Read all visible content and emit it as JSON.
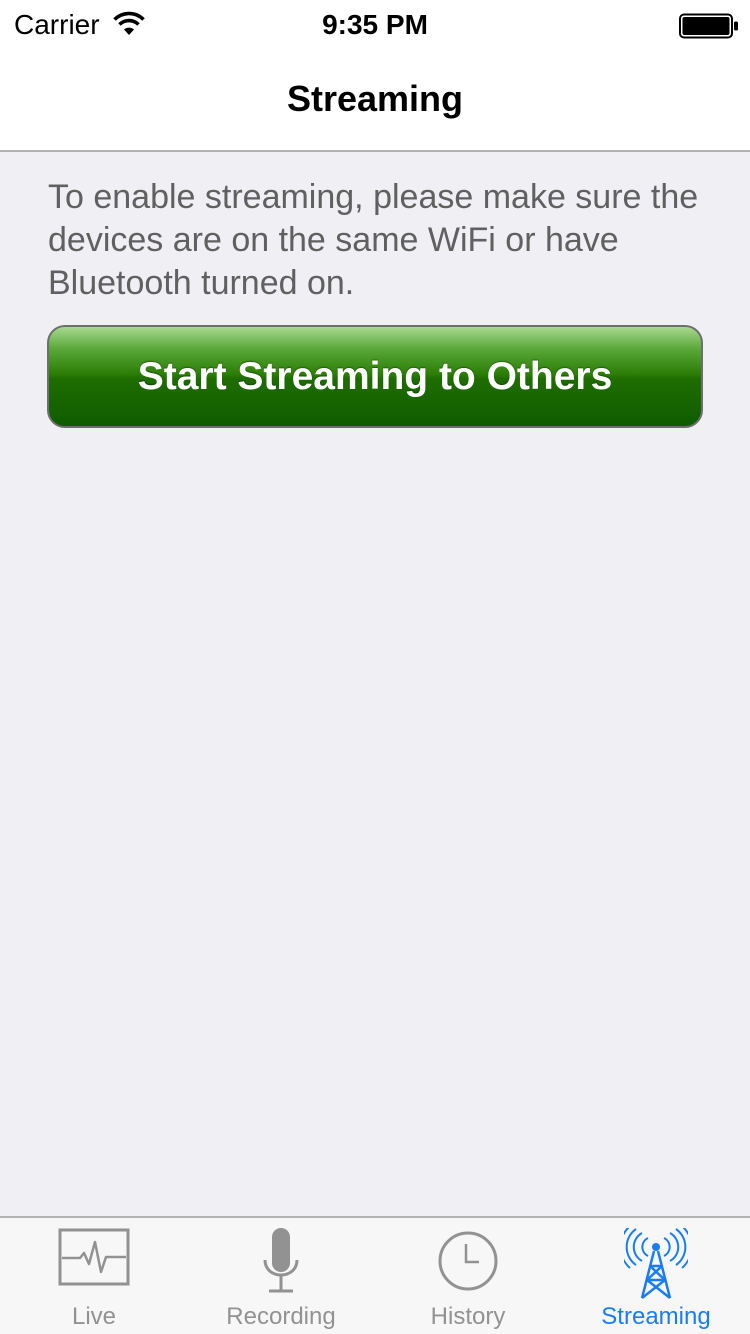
{
  "status_bar": {
    "carrier": "Carrier",
    "time": "9:35 PM",
    "wifi_icon": "wifi-icon",
    "battery_icon": "battery-icon"
  },
  "nav": {
    "title": "Streaming"
  },
  "main": {
    "instructions": "To enable streaming, please make sure the devices are on the same WiFi or have Bluetooth turned on.",
    "start_button_label": "Start Streaming to Others"
  },
  "tabs": [
    {
      "label": "Live",
      "icon": "waveform-icon",
      "active": false
    },
    {
      "label": "Recording",
      "icon": "microphone-icon",
      "active": false
    },
    {
      "label": "History",
      "icon": "clock-icon",
      "active": false
    },
    {
      "label": "Streaming",
      "icon": "broadcast-tower-icon",
      "active": true
    }
  ],
  "colors": {
    "accent": "#1a7cf5",
    "inactive_tab": "#929292",
    "button_green_top": "#a8d890",
    "button_green_bottom": "#0e5c00",
    "background": "#efeff4"
  }
}
